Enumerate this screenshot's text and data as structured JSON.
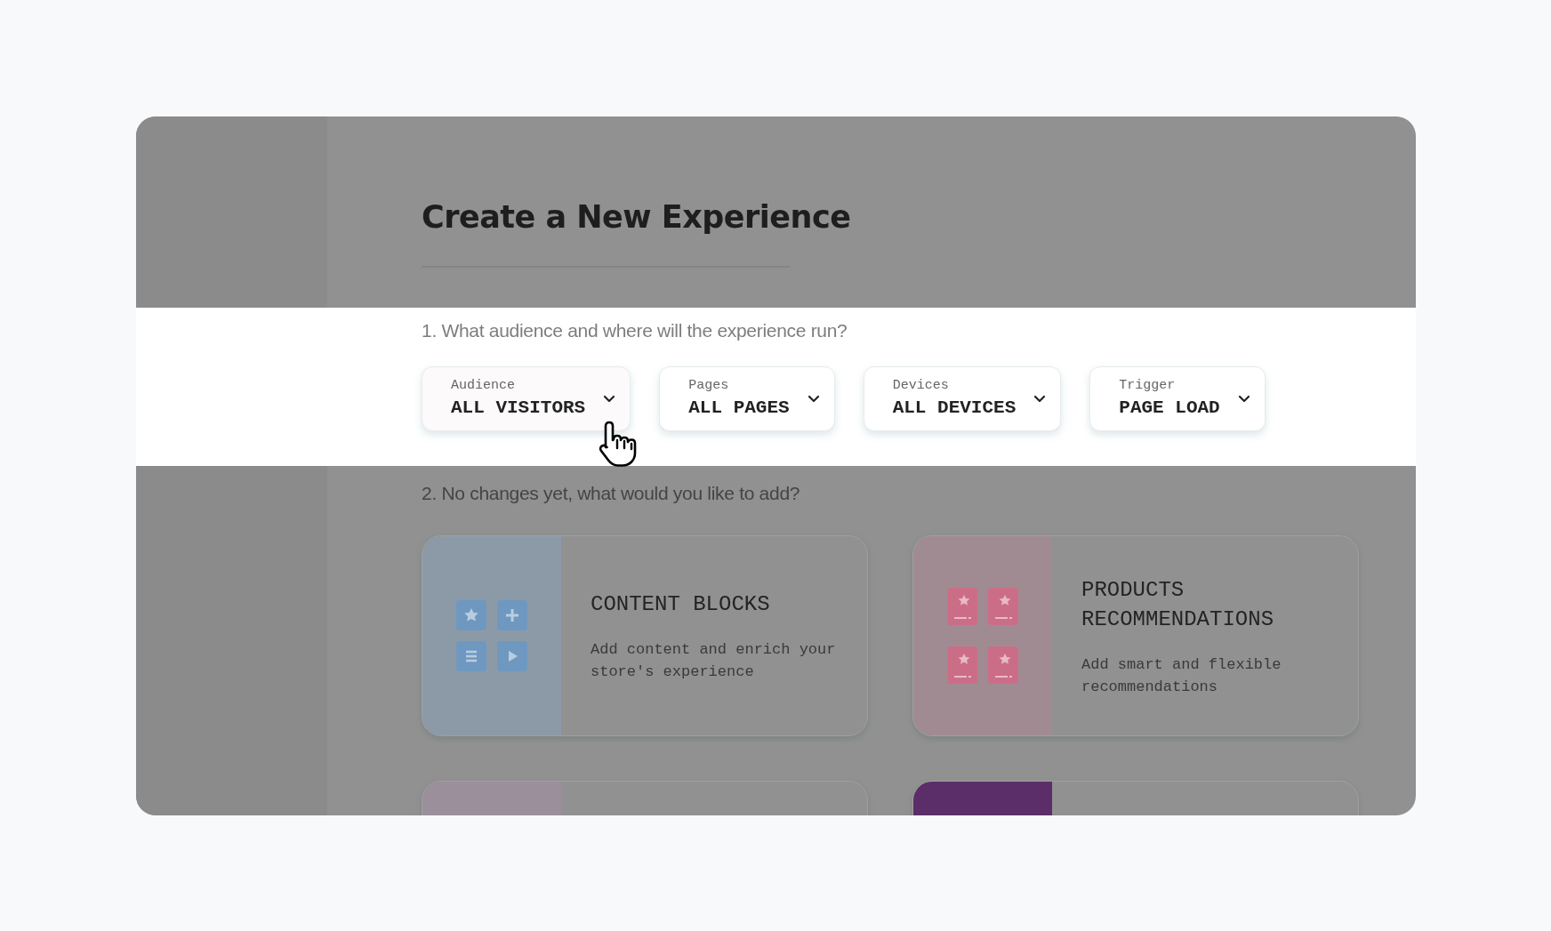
{
  "title": "Create a New Experience",
  "step_1": {
    "question": "1. What audience and where will the experience run?",
    "dropdowns": [
      {
        "label": "Audience",
        "value": "ALL VISITORS"
      },
      {
        "label": "Pages",
        "value": "ALL PAGES"
      },
      {
        "label": "Devices",
        "value": "ALL DEVICES"
      },
      {
        "label": "Trigger",
        "value": "PAGE LOAD"
      }
    ]
  },
  "step_2": {
    "question": "2. No changes yet, what would you like to add?",
    "cards": [
      {
        "kind": "blocks",
        "title": "CONTENT BLOCKS",
        "description": "Add content and enrich your store's experience",
        "color": "#8c9aa8"
      },
      {
        "kind": "products",
        "title": "PRODUCTS RECOMMENDATIONS",
        "description": "Add smart and flexible recommendations",
        "color": "#a18b93"
      },
      {
        "kind": "partial",
        "color": "#9c8f9c"
      },
      {
        "kind": "partial",
        "color": "#5b2e69"
      }
    ]
  }
}
